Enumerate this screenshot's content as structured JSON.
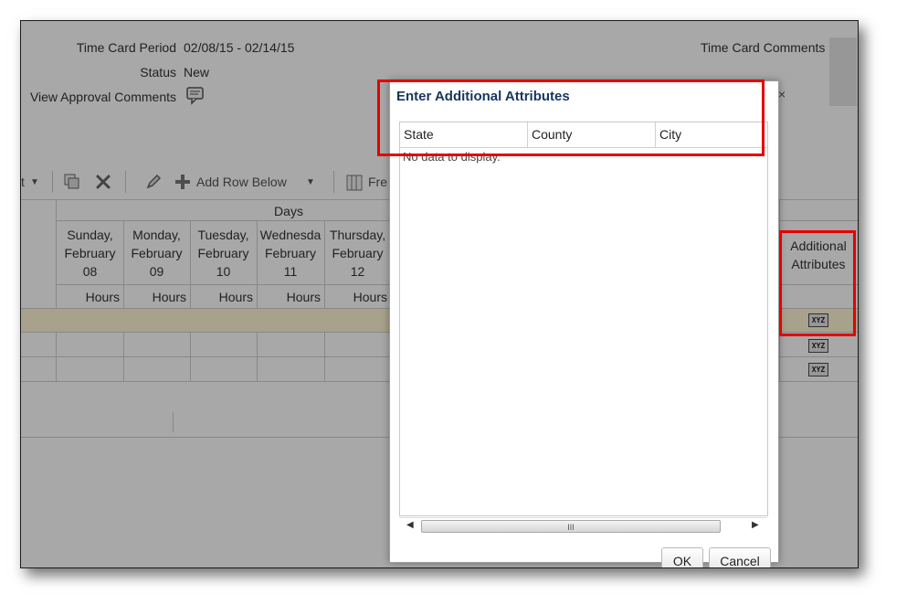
{
  "header": {
    "period_label": "Time Card Period",
    "period_value": "02/08/15 - 02/14/15",
    "status_label": "Status",
    "status_value": "New",
    "approval_label": "View Approval Comments",
    "comments_label": "Time Card Comments"
  },
  "toolbar": {
    "add_row_below": "Add Row Below",
    "freeze_partial": "Fre",
    "t_partial": "t"
  },
  "grid": {
    "days_group": "Days",
    "days": [
      {
        "line1": "Sunday,",
        "line2": "February",
        "line3": "08"
      },
      {
        "line1": "Monday,",
        "line2": "February",
        "line3": "09"
      },
      {
        "line1": "Tuesday,",
        "line2": "February",
        "line3": "10"
      },
      {
        "line1": "Wednesda",
        "line2": "February",
        "line3": "11"
      },
      {
        "line1": "Thursday,",
        "line2": "February",
        "line3": "12"
      }
    ],
    "hours_label": "Hours",
    "additional_line1": "Additional",
    "additional_line2": "Attributes",
    "xyz_label": "XYZ"
  },
  "popup": {
    "title": "Enter Additional Attributes",
    "close": "×",
    "columns": [
      "State",
      "County",
      "City"
    ],
    "empty_text": "No data to display.",
    "scroll_grip": "III",
    "ok_label": "OK",
    "cancel_label": "Cancel"
  },
  "colors": {
    "highlight": "#e60000",
    "title_color": "#17365d"
  }
}
